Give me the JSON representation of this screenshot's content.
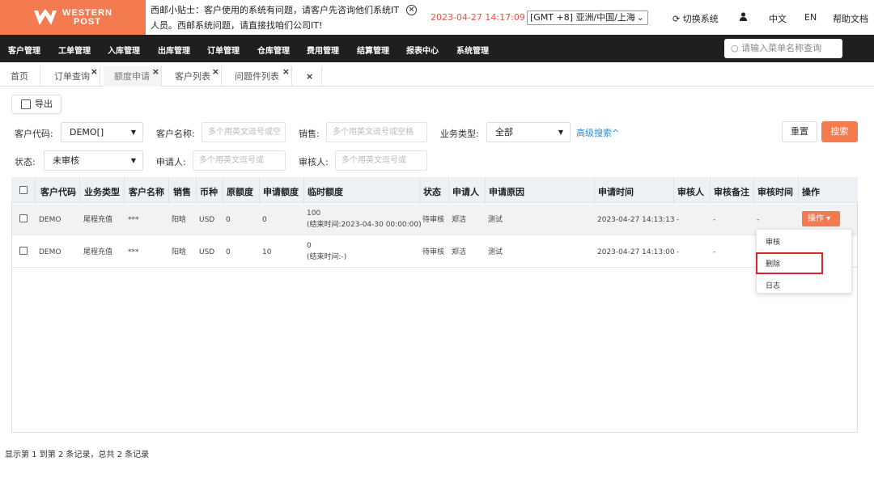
{
  "header": {
    "logo_line1": "WESTERN",
    "logo_line2": "POST",
    "tip_text": "西邮小贴士：客户使用的系统有问题，请客户先咨询他们系统IT人员。西邮系统问题，请直接找咱们公司IT!",
    "datetime": "2023-04-27 14:17:09",
    "timezone": "[GMT +8] 亚洲/中国/上海",
    "switch_system": "切换系统",
    "lang_zh": "中文",
    "lang_en": "EN",
    "help": "帮助文档"
  },
  "nav": {
    "items": [
      "客户管理",
      "工单管理",
      "入库管理",
      "出库管理",
      "订单管理",
      "仓库管理",
      "费用管理",
      "结算管理",
      "报表中心",
      "系统管理"
    ],
    "search_placeholder": "请输入菜单名称查询"
  },
  "tabs": [
    {
      "label": "首页"
    },
    {
      "label": "订单查询"
    },
    {
      "label": "额度申请"
    },
    {
      "label": "客户列表"
    },
    {
      "label": "问题件列表"
    }
  ],
  "toolbar": {
    "export": "导出",
    "customer_code_label": "客户代码:",
    "customer_code_value": "DEMO[]",
    "customer_name_label": "客户名称:",
    "customer_name_placeholder": "多个用英文逗号或空",
    "sales_label": "销售:",
    "sales_placeholder": "多个用英文逗号或空格",
    "biz_type_label": "业务类型:",
    "biz_type_value": "全部",
    "advanced": "高级搜索^",
    "status_label": "状态:",
    "status_value": "未审核",
    "applicant_label": "申请人:",
    "applicant_placeholder": "多个用英文逗号或",
    "reviewer_label": "审核人:",
    "reviewer_placeholder": "多个用英文逗号或",
    "reset": "重置",
    "search": "搜索"
  },
  "table": {
    "headers": [
      "客户代码",
      "业务类型",
      "客户名称",
      "销售",
      "币种",
      "原额度",
      "申请额度",
      "临时额度",
      "状态",
      "申请人",
      "申请原因",
      "申请时间",
      "审核人",
      "审核备注",
      "审核时间",
      "操作"
    ],
    "rows": [
      {
        "code": "DEMO",
        "biz": "尾程充值",
        "name": "***",
        "sales": "阳晗",
        "currency": "USD",
        "orig": "0",
        "apply": "0",
        "temp": "100",
        "temp_end": "(结束时间:2023-04-30 00:00:00)",
        "status": "待审核",
        "applicant": "郑洁",
        "reason": "测试",
        "apply_time": "2023-04-27 14:13:13",
        "reviewer": "-",
        "remark": "-",
        "review_time": "-"
      },
      {
        "code": "DEMO",
        "biz": "尾程充值",
        "name": "***",
        "sales": "阳晗",
        "currency": "USD",
        "orig": "0",
        "apply": "10",
        "temp": "0",
        "temp_end": "(结束时间:-)",
        "status": "待审核",
        "applicant": "郑洁",
        "reason": "测试",
        "apply_time": "2023-04-27 14:13:00",
        "reviewer": "-",
        "remark": "-",
        "review_time": ""
      }
    ],
    "op_button": "操作",
    "menu": [
      "审核",
      "删除",
      "日志"
    ]
  },
  "footer": "显示第 1 到第 2 条记录，总共 2 条记录",
  "colors": {
    "accent": "#f47b4f",
    "nav_bg": "#1f1f1f",
    "highlight": "#d9232d",
    "link": "#2a8fcf"
  }
}
